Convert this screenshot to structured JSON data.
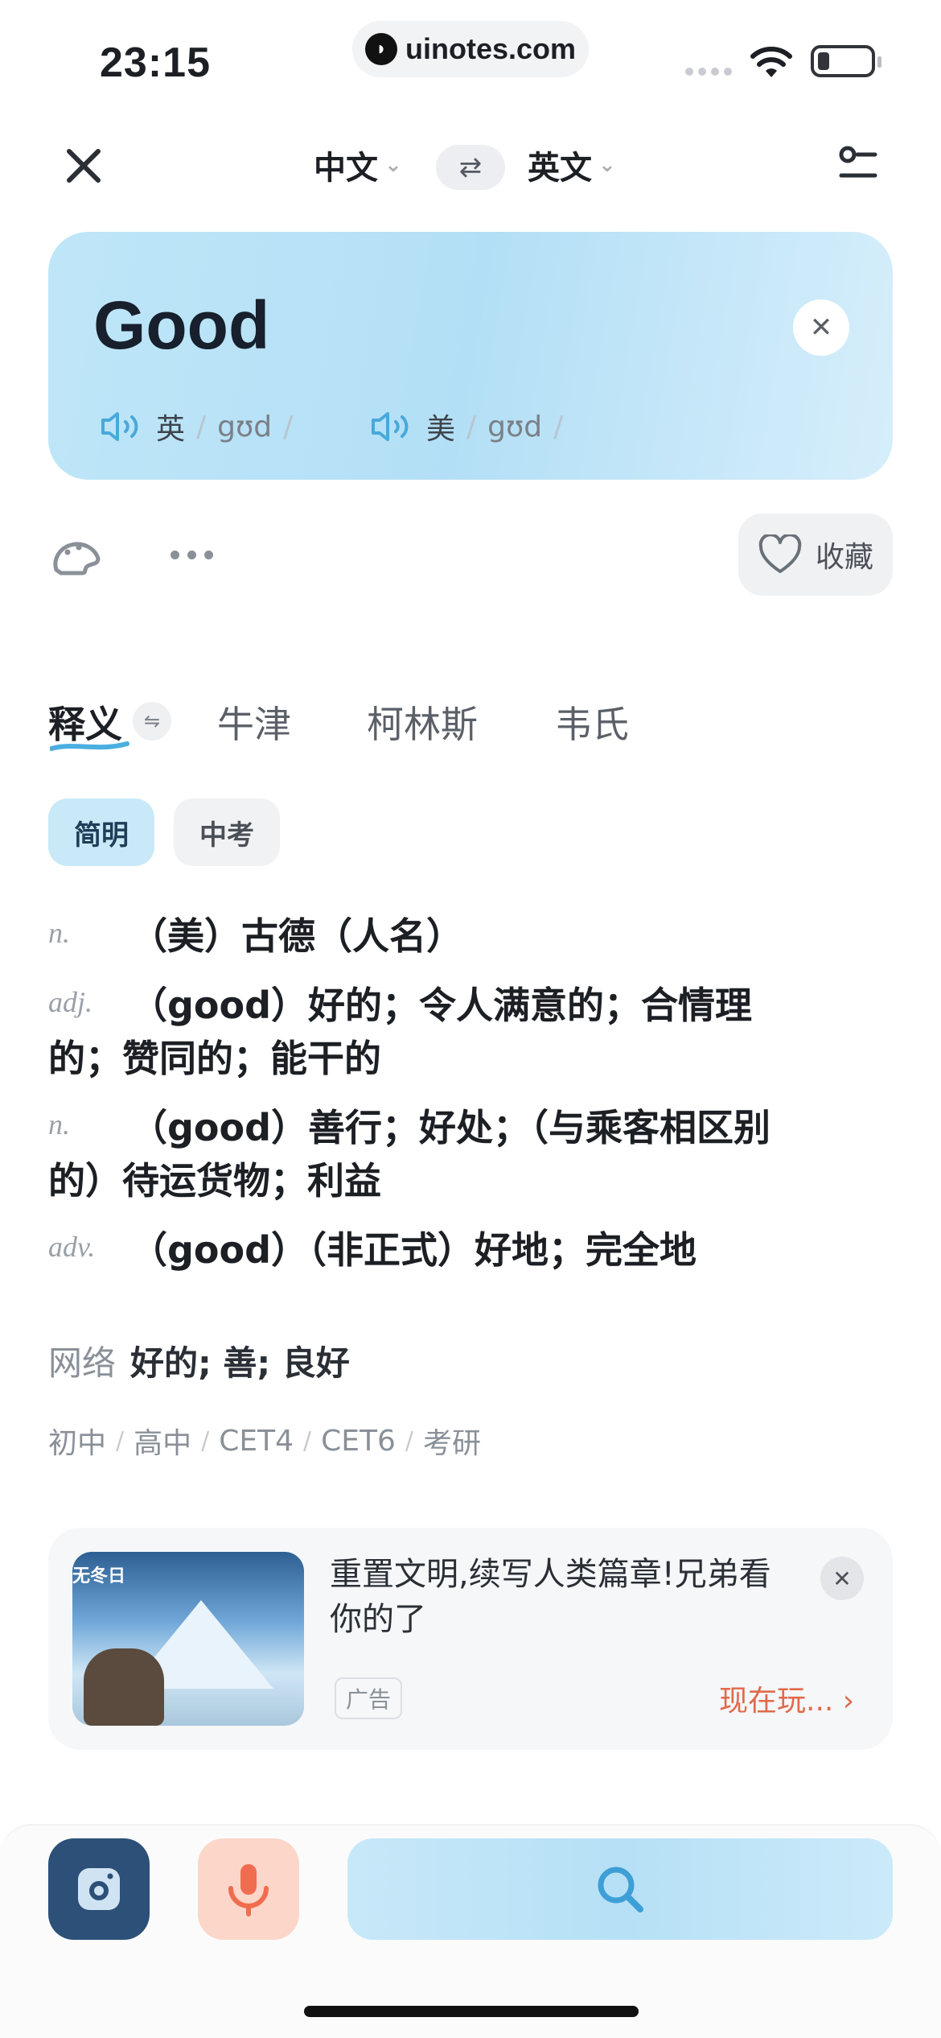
{
  "status": {
    "time": "23:15",
    "url": "uinotes.com"
  },
  "header": {
    "source_lang": "中文",
    "target_lang": "英文"
  },
  "word_card": {
    "word": "Good",
    "uk_label": "英",
    "uk_phonetic": "gʊd",
    "us_label": "美",
    "us_phonetic": "gʊd",
    "slash": "/"
  },
  "toolbar": {
    "favorite_label": "收藏"
  },
  "dict_tabs": [
    "释义",
    "牛津",
    "柯林斯",
    "韦氏"
  ],
  "chips": [
    "简明",
    "中考"
  ],
  "definitions": [
    {
      "pos": "n.",
      "meaning": "（美）古德（人名）"
    },
    {
      "pos": "adj.",
      "meaning": "（good）好的；令人满意的；合情理的；赞同的；能干的"
    },
    {
      "pos": "n.",
      "meaning": "（good）善行；好处；（与乘客相区别的）待运货物；利益"
    },
    {
      "pos": "adv.",
      "meaning": "（good）（非正式）好地；完全地"
    }
  ],
  "network": {
    "label": "网络",
    "value": "好的; 善; 良好"
  },
  "levels": [
    "初中",
    "高中",
    "CET4",
    "CET6",
    "考研"
  ],
  "ad": {
    "title": "重置文明,续写人类篇章!兄弟看你的了",
    "badge": "广告",
    "cta": "现在玩...",
    "image_tag": "无冬日"
  },
  "colors": {
    "accent_blue": "#b3dff6",
    "cta_orange": "#e16a4a",
    "camera_bg": "#2c5078",
    "mic_bg": "#fbd6c9"
  },
  "icons": [
    "close-icon",
    "swap-icon",
    "settings-icon",
    "speaker-icon",
    "palette-icon",
    "more-icon",
    "heart-icon",
    "camera-icon",
    "mic-icon",
    "search-icon"
  ]
}
